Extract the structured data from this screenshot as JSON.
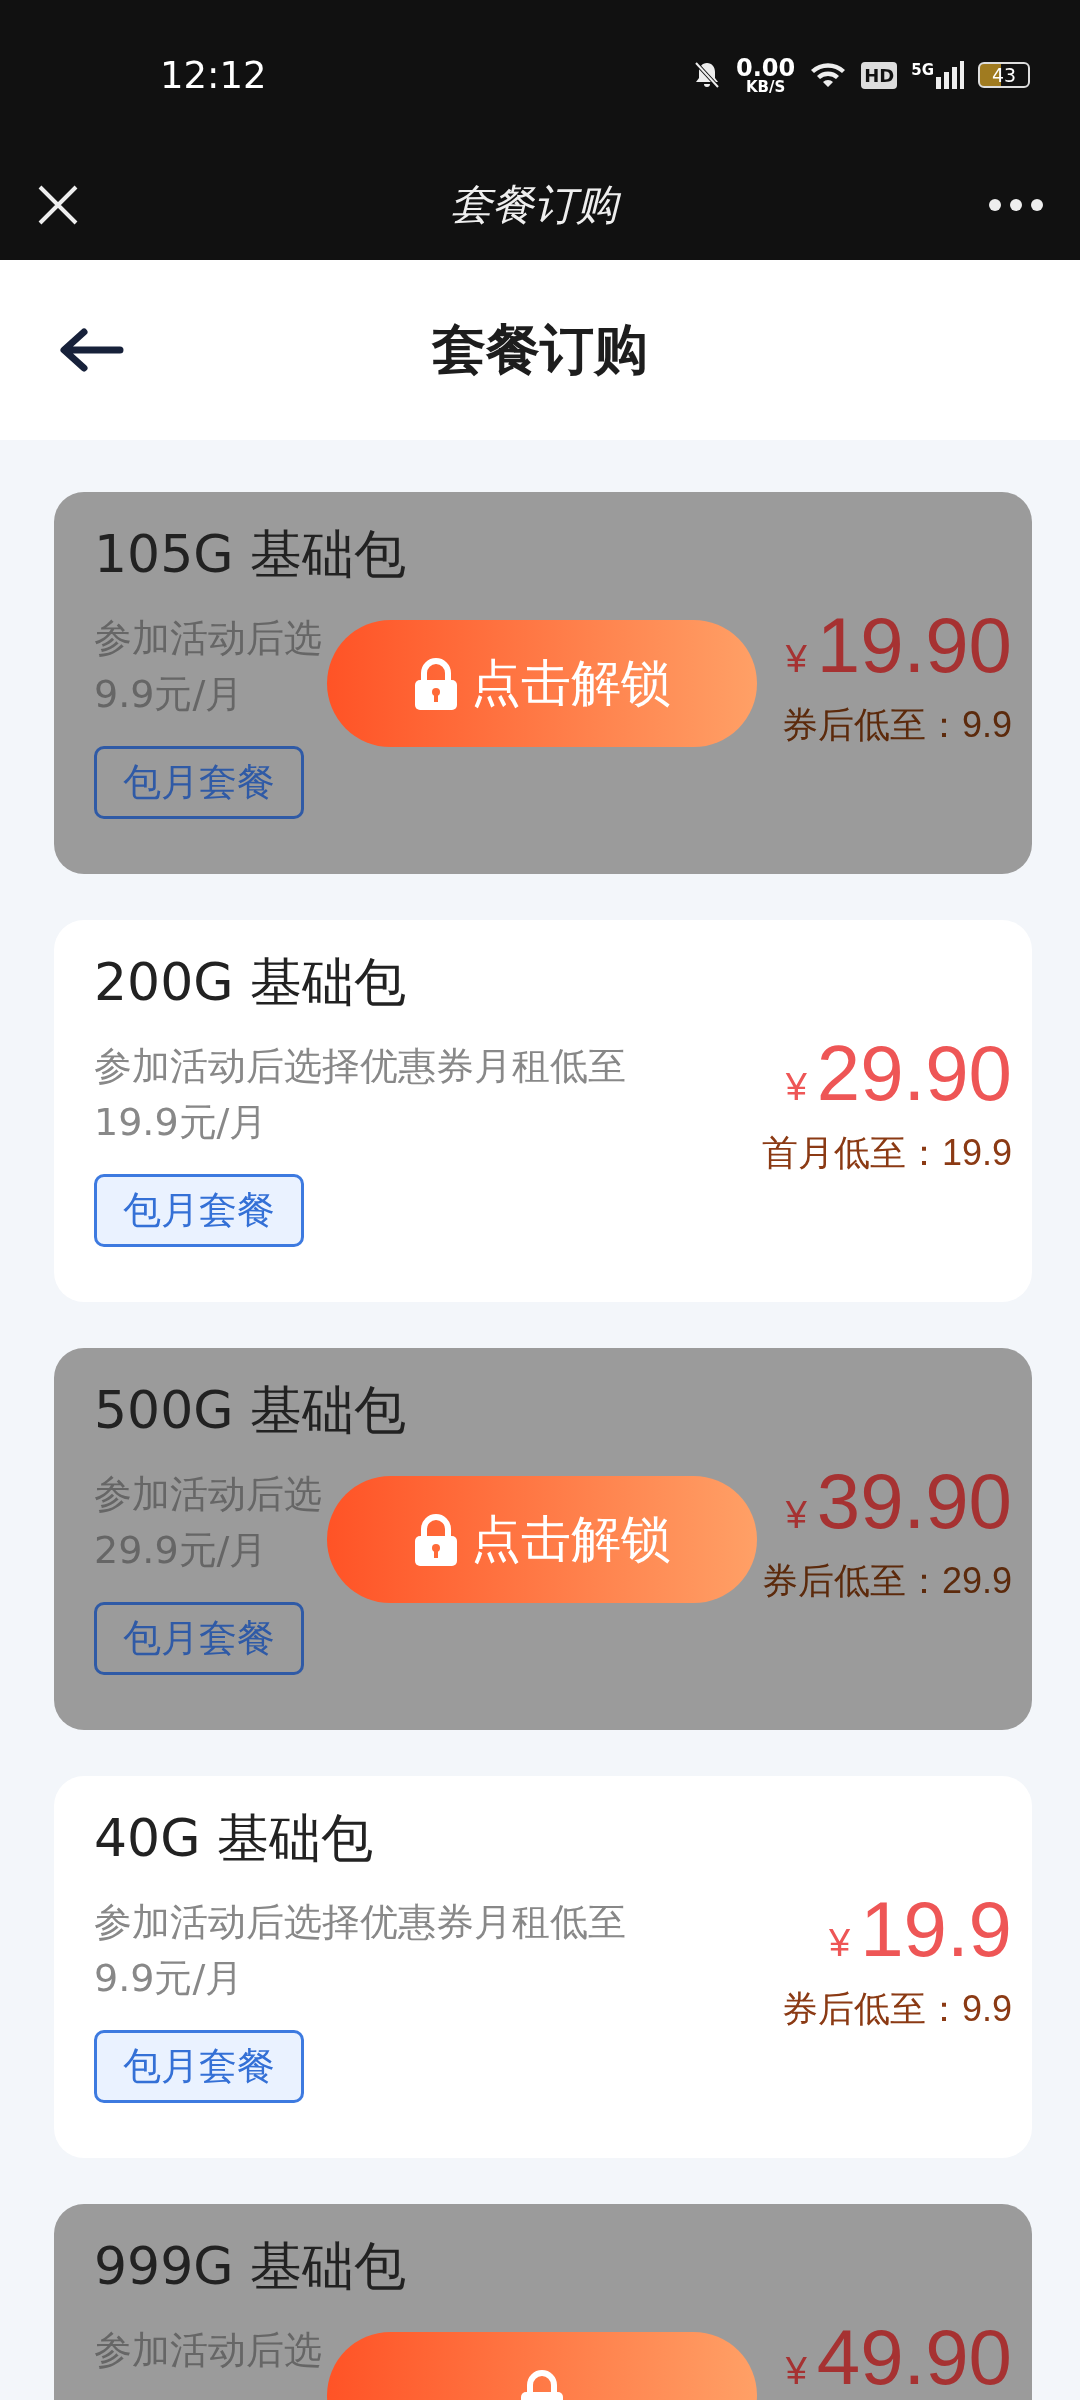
{
  "status_bar": {
    "time": "12:12",
    "net_speed": "0.00",
    "net_unit": "KB/S",
    "hd": "HD",
    "network": "5G",
    "battery": "43"
  },
  "nav_bar": {
    "title": "套餐订购"
  },
  "header": {
    "title": "套餐订购"
  },
  "plans": [
    {
      "title": "105G 基础包",
      "desc": [
        "参加活动后选",
        "9.9元/月"
      ],
      "tag": "包月套餐",
      "currency": "¥",
      "price": "19.90",
      "note": "券后低至：9.9",
      "locked": true,
      "unlock_label": "点击解锁"
    },
    {
      "title": "200G 基础包",
      "desc": [
        "参加活动后选择优惠券月租低至",
        "19.9元/月"
      ],
      "tag": "包月套餐",
      "currency": "¥",
      "price": "29.90",
      "note": "首月低至：19.9",
      "locked": false
    },
    {
      "title": "500G 基础包",
      "desc": [
        "参加活动后选",
        "29.9元/月"
      ],
      "tag": "包月套餐",
      "currency": "¥",
      "price": "39.90",
      "note": "券后低至：29.9",
      "locked": true,
      "unlock_label": "点击解锁"
    },
    {
      "title": "40G 基础包",
      "desc": [
        "参加活动后选择优惠券月租低至",
        "9.9元/月"
      ],
      "tag": "包月套餐",
      "currency": "¥",
      "price": "19.9",
      "note": "券后低至：9.9",
      "locked": false
    },
    {
      "title": "999G 基础包",
      "desc": [
        "参加活动后选"
      ],
      "currency": "¥",
      "price": "49.90",
      "locked": true
    }
  ]
}
